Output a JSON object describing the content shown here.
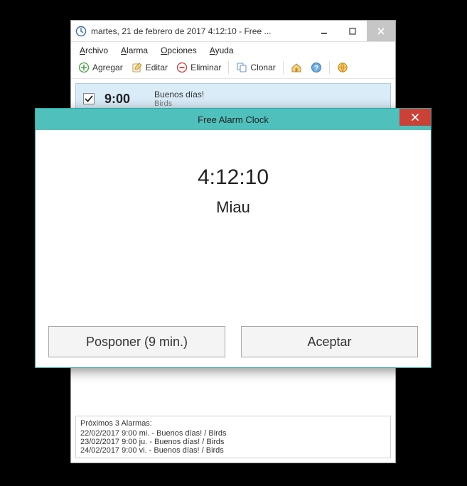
{
  "window": {
    "title": "martes, 21 de febrero de 2017 4:12:10  - Free ..."
  },
  "menu": {
    "file": "Archivo",
    "alarm": "Alarma",
    "options": "Opciones",
    "help": "Ayuda"
  },
  "toolbar": {
    "add": "Agregar",
    "edit": "Editar",
    "delete": "Eliminar",
    "clone": "Clonar"
  },
  "alarm": {
    "time": "9:00",
    "title": "Buenos días!",
    "sound": "Birds"
  },
  "next": {
    "header": "Próximos 3 Alarmas:",
    "rows": [
      "22/02/2017 9:00  mi. - Buenos días! / Birds",
      "23/02/2017 9:00  ju. - Buenos días! / Birds",
      "24/02/2017 9:00  vi. - Buenos días! / Birds"
    ]
  },
  "dialog": {
    "title": "Free Alarm Clock",
    "time": "4:12:10",
    "message": "Miau",
    "snooze": "Posponer (9 min.)",
    "accept": "Aceptar"
  }
}
